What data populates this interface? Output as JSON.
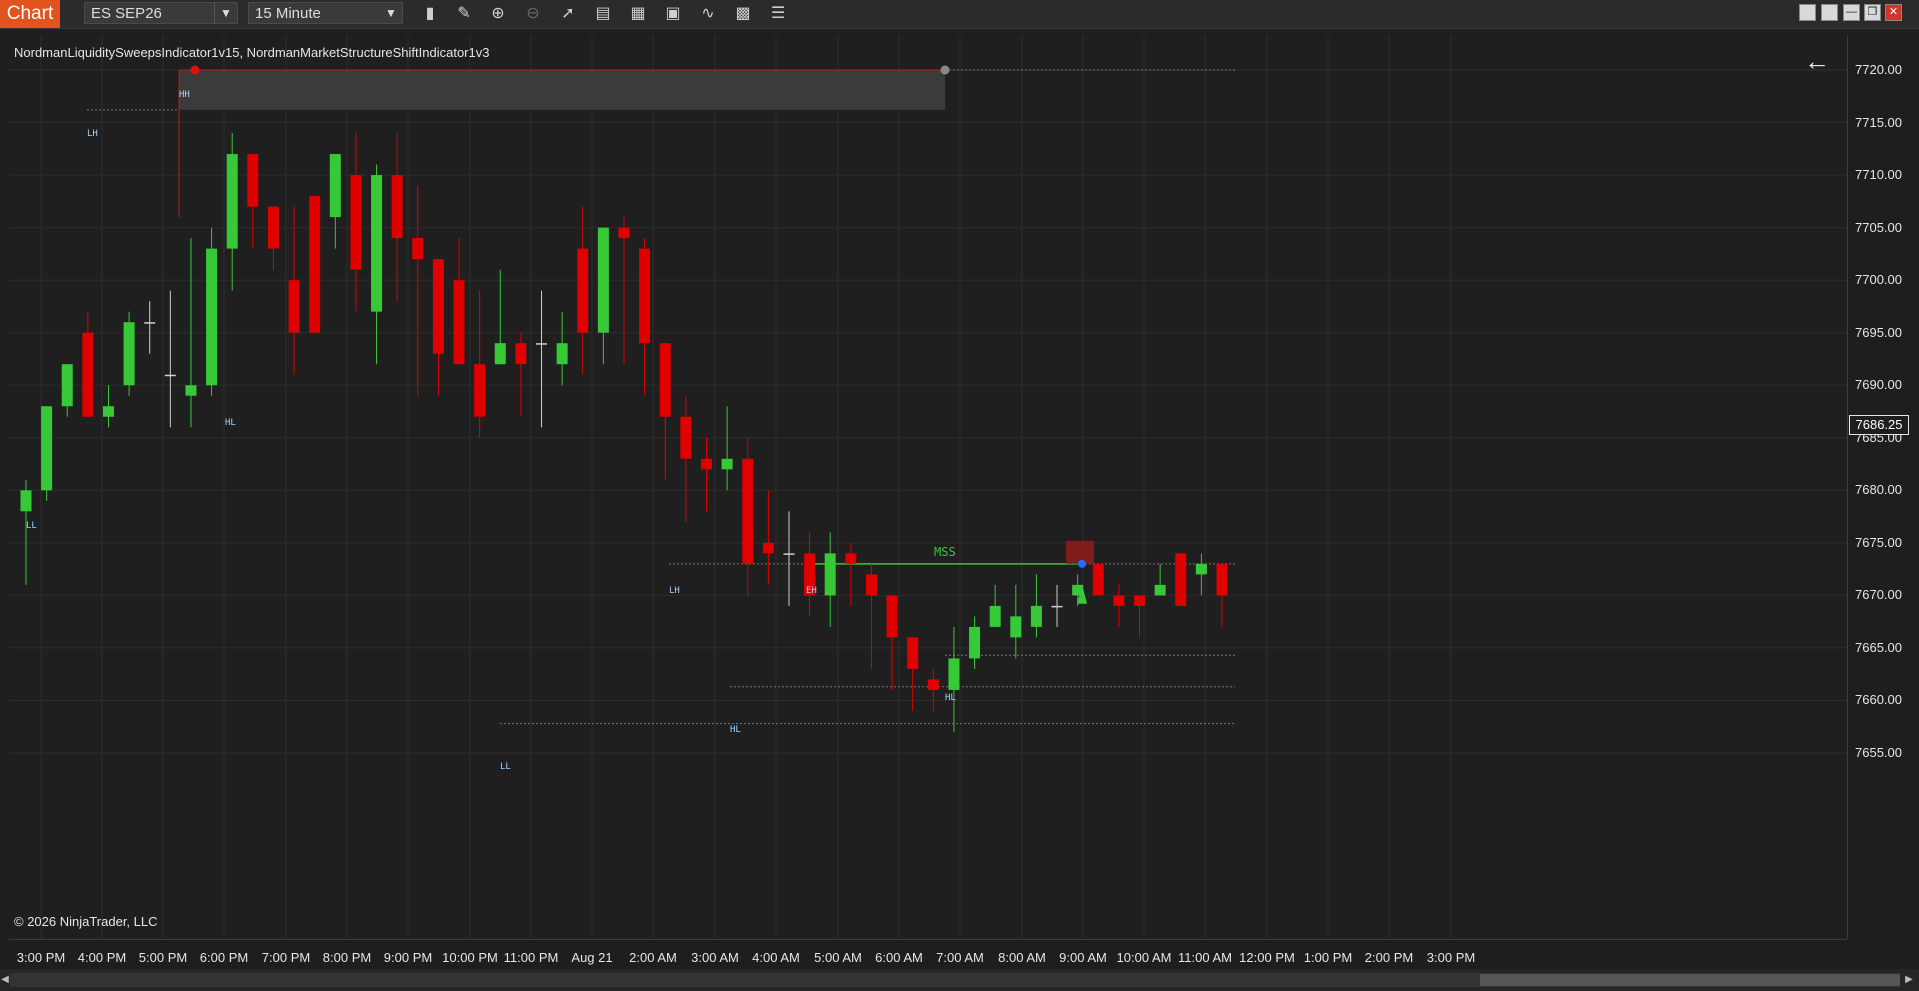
{
  "toolbar": {
    "chart_tab": "Chart",
    "instrument": "ES SEP26",
    "interval": "15 Minute",
    "icons": [
      "bar-type-icon",
      "draw-tool-icon",
      "zoom-in-icon",
      "zoom-out-icon",
      "pointer-icon",
      "data-box-icon",
      "chart-properties-icon",
      "strategies-icon",
      "indicators-icon",
      "templates-icon",
      "object-list-icon"
    ]
  },
  "window_buttons": [
    "tile-icon",
    "tile2-icon",
    "minimize-icon",
    "restore-icon",
    "close-icon"
  ],
  "chart": {
    "indicator_label": "NordmanLiquiditySweepsIndicator1v15, NordmanMarketStructureShiftIndicator1v3",
    "copyright": "© 2026 NinjaTrader, LLC",
    "last_price": "7686.25",
    "mss_label": "MSS",
    "colors": {
      "up": "#37c937",
      "down": "#e00000",
      "background": "#1f1f1f",
      "grid": "#2c2c2c",
      "swing_label": "#9fd3ff"
    }
  },
  "price_axis": [
    "7720.00",
    "7715.00",
    "7710.00",
    "7705.00",
    "7700.00",
    "7695.00",
    "7690.00",
    "7685.00",
    "7680.00",
    "7675.00",
    "7670.00",
    "7665.00",
    "7660.00",
    "7655.00"
  ],
  "time_axis": [
    "3:00 PM",
    "4:00 PM",
    "5:00 PM",
    "6:00 PM",
    "7:00 PM",
    "8:00 PM",
    "9:00 PM",
    "10:00 PM",
    "11:00 PM",
    "Aug 21",
    "2:00 AM",
    "3:00 AM",
    "4:00 AM",
    "5:00 AM",
    "6:00 AM",
    "7:00 AM",
    "8:00 AM",
    "9:00 AM",
    "10:00 AM",
    "11:00 AM",
    "12:00 PM",
    "1:00 PM",
    "2:00 PM",
    "3:00 PM"
  ],
  "swing_labels": [
    "LL",
    "LH",
    "HH",
    "HL",
    "LL",
    "LH",
    "HL",
    "EH",
    "HL"
  ],
  "chart_data": {
    "type": "candlestick",
    "timeframe": "15 Minute",
    "ylim": [
      7653,
      7723
    ],
    "candles": [
      [
        7678,
        7680,
        7681,
        7671
      ],
      [
        7680,
        7688,
        7688,
        7679
      ],
      [
        7688,
        7692,
        7692,
        7687
      ],
      [
        7695,
        7687,
        7697,
        7688
      ],
      [
        7687,
        7688,
        7690,
        7686
      ],
      [
        7690,
        7696,
        7697,
        7689
      ],
      [
        7696,
        7696,
        7698,
        7693
      ],
      [
        7691,
        7691,
        7699,
        7686
      ],
      [
        7689,
        7690,
        7704,
        7686
      ],
      [
        7690,
        7703,
        7705,
        7689
      ],
      [
        7703,
        7712,
        7714,
        7699
      ],
      [
        7712,
        7707,
        7712,
        7703
      ],
      [
        7707,
        7703,
        7707,
        7701
      ],
      [
        7700,
        7695,
        7707,
        7691
      ],
      [
        7708,
        7695,
        7708,
        7697
      ],
      [
        7706,
        7712,
        7712,
        7703
      ],
      [
        7710,
        7701,
        7714,
        7697
      ],
      [
        7697,
        7710,
        7711,
        7692
      ],
      [
        7710,
        7704,
        7714,
        7698
      ],
      [
        7704,
        7702,
        7709,
        7689
      ],
      [
        7702,
        7693,
        7702,
        7689
      ],
      [
        7700,
        7692,
        7704,
        7692
      ],
      [
        7692,
        7687,
        7699,
        7685
      ],
      [
        7692,
        7694,
        7701,
        7692
      ],
      [
        7694,
        7692,
        7695,
        7687
      ],
      [
        7694,
        7694,
        7699,
        7686
      ],
      [
        7692,
        7694,
        7697,
        7690
      ],
      [
        7703,
        7695,
        7707,
        7691
      ],
      [
        7695,
        7705,
        7705,
        7692
      ],
      [
        7705,
        7704,
        7706,
        7692
      ],
      [
        7703,
        7694,
        7704,
        7689
      ],
      [
        7694,
        7687,
        7694,
        7681
      ],
      [
        7687,
        7683,
        7689,
        7677
      ],
      [
        7683,
        7682,
        7685,
        7678
      ],
      [
        7682,
        7683,
        7688,
        7680
      ],
      [
        7683,
        7673,
        7685,
        7670
      ],
      [
        7675,
        7674,
        7680,
        7671
      ],
      [
        7674,
        7674,
        7678,
        7669
      ],
      [
        7674,
        7670,
        7676,
        7668
      ],
      [
        7670,
        7674,
        7676,
        7667
      ],
      [
        7674,
        7673,
        7675,
        7669
      ],
      [
        7672,
        7670,
        7673,
        7663
      ],
      [
        7670,
        7666,
        7670,
        7661
      ],
      [
        7666,
        7663,
        7664,
        7659
      ],
      [
        7662,
        7661,
        7663,
        7659
      ],
      [
        7661,
        7664,
        7667,
        7657
      ],
      [
        7664,
        7667,
        7668,
        7663
      ],
      [
        7667,
        7669,
        7671,
        7667
      ],
      [
        7666,
        7668,
        7671,
        7664
      ],
      [
        7667,
        7669,
        7672,
        7666
      ],
      [
        7669,
        7669,
        7671,
        7667
      ],
      [
        7670,
        7671,
        7672,
        7669
      ],
      [
        7673,
        7670,
        7673,
        7670
      ],
      [
        7670,
        7669,
        7671,
        7667
      ],
      [
        7670,
        7669,
        7670,
        7666
      ],
      [
        7670,
        7671,
        7673,
        7670
      ],
      [
        7674,
        7669,
        7674,
        7670
      ],
      [
        7672,
        7673,
        7674,
        7670
      ],
      [
        7673,
        7670,
        7673,
        7667
      ]
    ],
    "levels": [
      {
        "label": "HH",
        "price": 7720.0
      },
      {
        "label": "LH",
        "price": 7716.2
      },
      {
        "label": "LH",
        "price": 7673.0
      },
      {
        "label": "MSS",
        "price": 7673.0
      },
      {
        "label": "HL",
        "price": 7664.3
      },
      {
        "label": "HL",
        "price": 7661.3
      },
      {
        "label": "LL",
        "price": 7657.8
      }
    ],
    "last_price": 7686.25,
    "xlabel": "",
    "ylabel": ""
  }
}
